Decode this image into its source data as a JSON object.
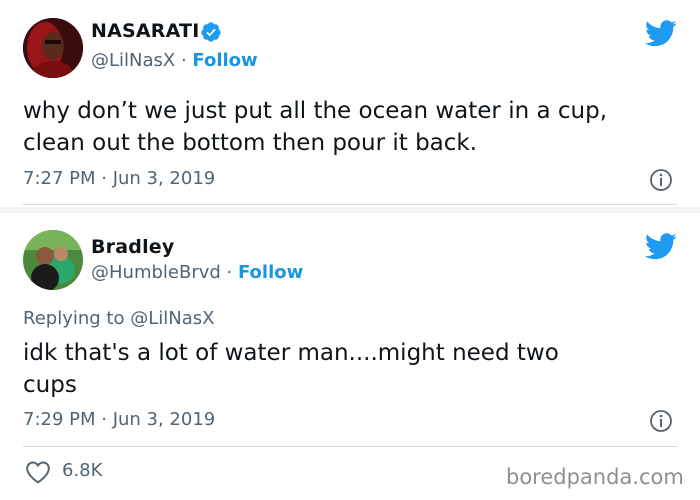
{
  "tweets": [
    {
      "display_name": "NASARATI",
      "handle": "@LilNasX",
      "separator": " · ",
      "follow_label": "Follow",
      "verified": true,
      "text_lines": [
        "why don’t we just put all the ocean water in a cup,",
        "clean out the bottom then pour it back."
      ],
      "timestamp": "7:27 PM · Jun 3, 2019"
    },
    {
      "display_name": "Bradley",
      "handle": "@HumbleBrvd",
      "separator": " · ",
      "follow_label": "Follow",
      "verified": false,
      "replying_to": "Replying to @LilNasX",
      "text_lines": [
        "idk that's a lot of water man....might need two",
        "cups"
      ],
      "timestamp": "7:29 PM · Jun 3, 2019",
      "likes": "6.8K"
    }
  ],
  "watermark": "boredpanda.com",
  "colors": {
    "follow": "#1b95e0",
    "twitter_bird": "#1d9bf0",
    "meta_gray": "#536471",
    "verified_badge": "#1d9bf0"
  },
  "icons": {
    "bird": "twitter-bird-icon",
    "verified": "verified-badge-icon",
    "info": "info-icon",
    "heart": "heart-icon"
  }
}
